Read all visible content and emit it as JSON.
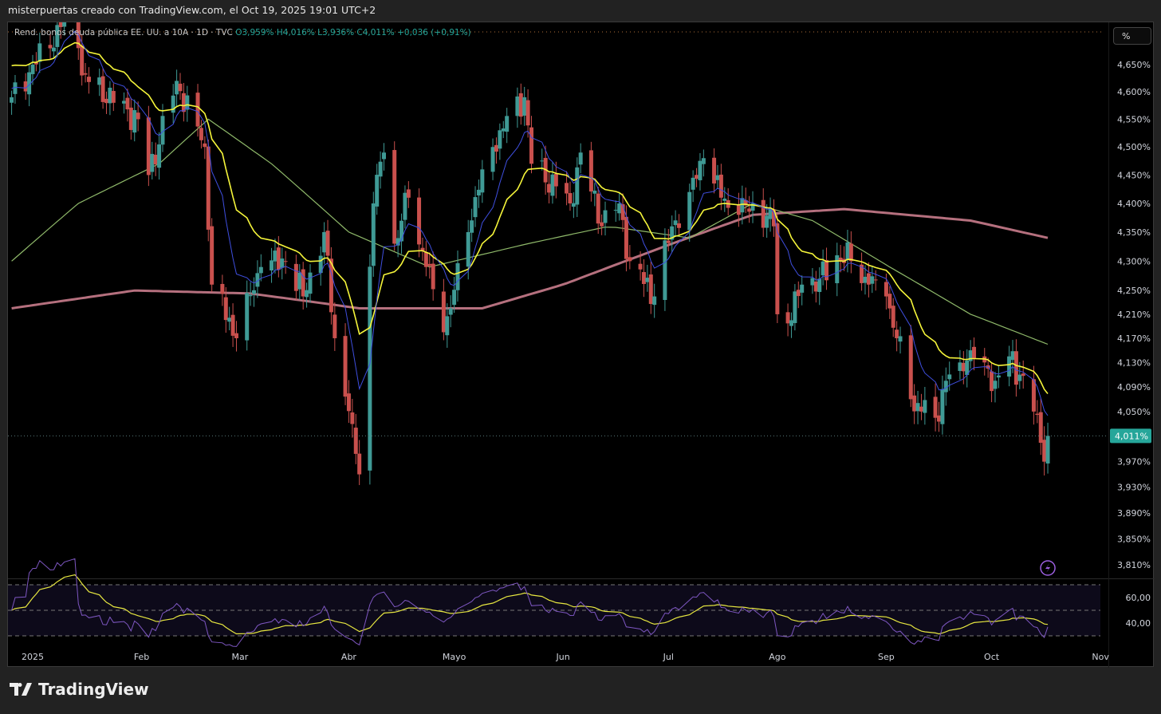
{
  "header": {
    "title": "misterpuertas creado con TradingView.com, el Oct 19, 2025 19:01 UTC+2"
  },
  "legend": {
    "symbol": "Rend. bonos deuda pública EE. UU. a 10A · 1D · TVC",
    "open": "O3,959%",
    "high": "H4,016%",
    "low": "L3,936%",
    "close": "C4,011%",
    "change": "+0,036 (+0,91%)"
  },
  "axis": {
    "unit_button": "%",
    "current_price_label": "4,011%"
  },
  "footer": {
    "brand": "TradingView"
  },
  "colors": {
    "up": "#3f9a95",
    "down": "#c9504d",
    "ema_fast": "#3f4fe0",
    "ema_slow": "#f5f53a",
    "sma50": "#8fb96a",
    "sma200": "#b5707e",
    "rsi": "#7e57c2",
    "rsi_ma": "#e6e640",
    "last": "#26a69a"
  },
  "chart_data": {
    "type": "candlestick",
    "title": "Rend. bonos deuda pública EE. UU. a 10A",
    "interval": "1D",
    "yscale": "log",
    "ylim": [
      3.79,
      4.82
    ],
    "yticks": [
      4.65,
      4.6,
      4.55,
      4.5,
      4.45,
      4.4,
      4.35,
      4.3,
      4.25,
      4.21,
      4.17,
      4.13,
      4.09,
      4.05,
      3.97,
      3.93,
      3.89,
      3.85,
      3.81
    ],
    "ytick_labels": [
      "4,650%",
      "4,600%",
      "4,550%",
      "4,500%",
      "4,450%",
      "4,400%",
      "4,350%",
      "4,300%",
      "4,250%",
      "4,210%",
      "4,170%",
      "4,130%",
      "4,090%",
      "4,050%",
      "3,970%",
      "3,930%",
      "3,890%",
      "3,850%",
      "3,810%"
    ],
    "xticks": [
      {
        "date": "2025-01-01",
        "label": "2025"
      },
      {
        "date": "2025-02-01",
        "label": "Feb"
      },
      {
        "date": "2025-03-01",
        "label": "Mar"
      },
      {
        "date": "2025-04-01",
        "label": "Abr"
      },
      {
        "date": "2025-05-01",
        "label": "Mayo"
      },
      {
        "date": "2025-06-01",
        "label": "Jun"
      },
      {
        "date": "2025-07-01",
        "label": "Jul"
      },
      {
        "date": "2025-08-01",
        "label": "Ago"
      },
      {
        "date": "2025-09-01",
        "label": "Sep"
      },
      {
        "date": "2025-10-01",
        "label": "Oct"
      },
      {
        "date": "2025-11-01",
        "label": "Nov"
      }
    ],
    "last_close": 4.011,
    "close_keypoints": [
      [
        "2024-12-26",
        4.59
      ],
      [
        "2025-01-09",
        4.72
      ],
      [
        "2025-01-13",
        4.79
      ],
      [
        "2025-01-15",
        4.63
      ],
      [
        "2025-01-31",
        4.55
      ],
      [
        "2025-02-03",
        4.45
      ],
      [
        "2025-02-11",
        4.62
      ],
      [
        "2025-02-19",
        4.5
      ],
      [
        "2025-02-21",
        4.26
      ],
      [
        "2025-02-28",
        4.17
      ],
      [
        "2025-03-07",
        4.29
      ],
      [
        "2025-03-14",
        4.3
      ],
      [
        "2025-03-19",
        4.24
      ],
      [
        "2025-03-25",
        4.35
      ],
      [
        "2025-03-28",
        4.17
      ],
      [
        "2025-04-02",
        4.03
      ],
      [
        "2025-04-04",
        3.95
      ],
      [
        "2025-04-08",
        4.4
      ],
      [
        "2025-04-11",
        4.49
      ],
      [
        "2025-04-14",
        4.33
      ],
      [
        "2025-04-18",
        4.41
      ],
      [
        "2025-04-23",
        4.29
      ],
      [
        "2025-04-28",
        4.18
      ],
      [
        "2025-04-30",
        4.22
      ],
      [
        "2025-05-05",
        4.35
      ],
      [
        "2025-05-09",
        4.46
      ],
      [
        "2025-05-14",
        4.53
      ],
      [
        "2025-05-21",
        4.59
      ],
      [
        "2025-05-23",
        4.47
      ],
      [
        "2025-05-30",
        4.43
      ],
      [
        "2025-06-03",
        4.4
      ],
      [
        "2025-06-06",
        4.49
      ],
      [
        "2025-06-12",
        4.36
      ],
      [
        "2025-06-17",
        4.4
      ],
      [
        "2025-06-20",
        4.3
      ],
      [
        "2025-06-27",
        4.24
      ],
      [
        "2025-07-02",
        4.36
      ],
      [
        "2025-07-07",
        4.42
      ],
      [
        "2025-07-11",
        4.48
      ],
      [
        "2025-07-16",
        4.41
      ],
      [
        "2025-07-21",
        4.38
      ],
      [
        "2025-07-25",
        4.4
      ],
      [
        "2025-07-31",
        4.36
      ],
      [
        "2025-08-01",
        4.21
      ],
      [
        "2025-08-05",
        4.2
      ],
      [
        "2025-08-08",
        4.26
      ],
      [
        "2025-08-13",
        4.27
      ],
      [
        "2025-08-18",
        4.31
      ],
      [
        "2025-08-22",
        4.3
      ],
      [
        "2025-08-27",
        4.26
      ],
      [
        "2025-09-01",
        4.24
      ],
      [
        "2025-09-04",
        4.17
      ],
      [
        "2025-09-08",
        4.07
      ],
      [
        "2025-09-11",
        4.05
      ],
      [
        "2025-09-15",
        4.04
      ],
      [
        "2025-09-18",
        4.1
      ],
      [
        "2025-09-22",
        4.13
      ],
      [
        "2025-09-25",
        4.15
      ],
      [
        "2025-09-29",
        4.13
      ],
      [
        "2025-10-02",
        4.1
      ],
      [
        "2025-10-06",
        4.14
      ],
      [
        "2025-10-09",
        4.11
      ],
      [
        "2025-10-13",
        4.05
      ],
      [
        "2025-10-15",
        4.0
      ],
      [
        "2025-10-16",
        3.97
      ],
      [
        "2025-10-17",
        4.011
      ]
    ],
    "sma50_keypoints": [
      [
        "2024-12-26",
        4.3
      ],
      [
        "2025-01-14",
        4.4
      ],
      [
        "2025-02-06",
        4.47
      ],
      [
        "2025-02-20",
        4.55
      ],
      [
        "2025-03-10",
        4.47
      ],
      [
        "2025-04-01",
        4.35
      ],
      [
        "2025-04-24",
        4.29
      ],
      [
        "2025-05-22",
        4.33
      ],
      [
        "2025-06-14",
        4.36
      ],
      [
        "2025-07-07",
        4.34
      ],
      [
        "2025-07-25",
        4.4
      ],
      [
        "2025-08-11",
        4.37
      ],
      [
        "2025-09-02",
        4.29
      ],
      [
        "2025-09-25",
        4.21
      ],
      [
        "2025-10-17",
        4.16
      ]
    ],
    "sma200_keypoints": [
      [
        "2024-12-26",
        4.22
      ],
      [
        "2025-01-30",
        4.25
      ],
      [
        "2025-03-04",
        4.245
      ],
      [
        "2025-04-04",
        4.22
      ],
      [
        "2025-05-09",
        4.22
      ],
      [
        "2025-06-01",
        4.26
      ],
      [
        "2025-07-02",
        4.33
      ],
      [
        "2025-07-25",
        4.38
      ],
      [
        "2025-08-20",
        4.39
      ],
      [
        "2025-09-25",
        4.37
      ],
      [
        "2025-10-17",
        4.34
      ]
    ],
    "rsi": {
      "length": 14,
      "upper": 70,
      "middle": 50,
      "lower": 30,
      "tick_labels": [
        "60,00",
        "40,00"
      ],
      "ticks": [
        60,
        40
      ]
    }
  }
}
